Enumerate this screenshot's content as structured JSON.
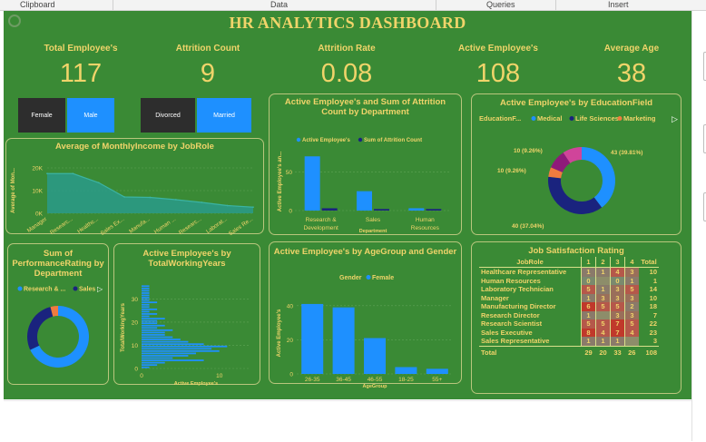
{
  "ribbon": [
    "Clipboard",
    "Data",
    "Queries",
    "Insert"
  ],
  "title": "HR ANALYTICS DASHBOARD",
  "kpis": [
    {
      "label": "Total Employee's",
      "value": "117"
    },
    {
      "label": "Attrition Count",
      "value": "9"
    },
    {
      "label": "Attrition Rate",
      "value": "0.08"
    },
    {
      "label": "Active Employee's",
      "value": "108"
    },
    {
      "label": "Average Age",
      "value": "38"
    }
  ],
  "slicers": {
    "gender": {
      "left": "Female",
      "right": "Male"
    },
    "marital": {
      "left": "Divorced",
      "right": "Married"
    }
  },
  "colors": {
    "dash_bg": "#3a8a35",
    "accent_gold": "#f0d46a",
    "bar_blue": "#1e90ff",
    "navy": "#1a237e",
    "orange": "#f07b3f",
    "purple": "#8e1a7a",
    "pink": "#d0449a"
  },
  "income_chart": {
    "type": "area",
    "title": "Average of MonthlyIncome by JobRole",
    "ylabel": "Average of Mon...",
    "y_ticks": [
      "20K",
      "10K",
      "0K"
    ],
    "ylim": [
      0,
      20000
    ],
    "categories": [
      "Manager",
      "Researc...",
      "Healthc...",
      "Sales Ex...",
      "Manufa...",
      "Human ...",
      "Researc...",
      "Laborat...",
      "Sales Re..."
    ],
    "values": [
      17500,
      17500,
      13500,
      7200,
      7000,
      6000,
      4800,
      3400,
      2700
    ]
  },
  "dept_chart": {
    "type": "bar",
    "title": "Active Employee's and Sum of Attrition Count by Department",
    "legend": [
      "Active Employee's",
      "Sum of Attrition Count"
    ],
    "ylabel": "Active Employee's an...",
    "xlabel": "Department",
    "y_ticks": [
      "50",
      "0"
    ],
    "ylim": [
      0,
      75
    ],
    "categories": [
      "Research & Development",
      "Sales",
      "Human Resources"
    ],
    "cat_lines": [
      [
        "Research &",
        "Development"
      ],
      [
        "Sales"
      ],
      [
        "Human",
        "Resources"
      ]
    ],
    "series": [
      {
        "name": "Active Employee's",
        "values": [
          70,
          25,
          3
        ]
      },
      {
        "name": "Sum of Attrition Count",
        "values": [
          3,
          2,
          2
        ]
      }
    ]
  },
  "edu_chart": {
    "type": "pie",
    "title": "Active Employee's by EducationField",
    "legend_title": "EducationF...",
    "legend": [
      "Medical",
      "Life Sciences",
      "Marketing"
    ],
    "slices": [
      {
        "name": "Medical",
        "value": 43,
        "label": "43 (39.81%)",
        "color": "#1e90ff"
      },
      {
        "name": "Life Sciences",
        "value": 40,
        "label": "40 (37.04%)",
        "color": "#1a237e"
      },
      {
        "name": "Marketing",
        "value": 5,
        "label": "",
        "color": "#f07b3f"
      },
      {
        "name": "",
        "value": 10,
        "label": "10 (9.26%)",
        "color": "#8e1a7a"
      },
      {
        "name": "",
        "value": 10,
        "label": "10 (9.26%)",
        "color": "#d0449a"
      }
    ]
  },
  "perf_chart": {
    "type": "pie",
    "title": "Sum of PerformanceRating by Department",
    "legend": [
      "Research & ...",
      "Sales"
    ],
    "slices": [
      {
        "name": "Research & Development",
        "value": 68,
        "color": "#1e90ff"
      },
      {
        "name": "Sales",
        "value": 28,
        "color": "#1a237e"
      },
      {
        "name": "",
        "value": 4,
        "color": "#f07b3f"
      }
    ]
  },
  "years_chart": {
    "type": "bar",
    "title": "Active Employee's by TotalWorkingYears",
    "ylabel": "TotalWorkingYears",
    "xlabel": "Active Employee's",
    "x_ticks": [
      "0",
      "10"
    ],
    "y_ticks": [
      "30",
      "20",
      "10",
      "0"
    ],
    "ylim": [
      0,
      36
    ],
    "xlim": [
      0,
      14
    ],
    "values": [
      1,
      2,
      3,
      8,
      4,
      6,
      7,
      10,
      9,
      11,
      8,
      6,
      5,
      4,
      3,
      3,
      4,
      2,
      3,
      2,
      2,
      3,
      1,
      2,
      1,
      2,
      1,
      1,
      2,
      1,
      1,
      1,
      1,
      1,
      1,
      1
    ]
  },
  "age_chart": {
    "type": "bar",
    "title": "Active Employee's by AgeGroup and Gender",
    "legend_title": "Gender",
    "legend": [
      "Female"
    ],
    "ylabel": "Active Employee's",
    "xlabel": "AgeGroup",
    "y_ticks": [
      "40",
      "20",
      "0"
    ],
    "ylim": [
      0,
      50
    ],
    "categories": [
      "26-35",
      "36-45",
      "46-55",
      "18-25",
      "55+"
    ],
    "values": [
      41,
      39,
      21,
      4,
      3
    ]
  },
  "satisfaction": {
    "type": "table",
    "title": "Job Satisfaction Rating",
    "headers": [
      "JobRole",
      "1",
      "2",
      "3",
      "4",
      "Total"
    ],
    "rows": [
      [
        "Healthcare Representative",
        "1",
        "1",
        "4",
        "3",
        "10"
      ],
      [
        "Human Resources",
        "0",
        "",
        "0",
        "1",
        "1"
      ],
      [
        "Laboratory Technician",
        "5",
        "1",
        "3",
        "5",
        "14"
      ],
      [
        "Manager",
        "1",
        "3",
        "3",
        "3",
        "10"
      ],
      [
        "Manufacturing Director",
        "6",
        "5",
        "5",
        "2",
        "18"
      ],
      [
        "Research Director",
        "1",
        "",
        "3",
        "3",
        "7"
      ],
      [
        "Research Scientist",
        "5",
        "5",
        "7",
        "5",
        "22"
      ],
      [
        "Sales Executive",
        "8",
        "4",
        "7",
        "4",
        "23"
      ],
      [
        "Sales Representative",
        "1",
        "1",
        "1",
        "",
        "3"
      ]
    ],
    "total": [
      "Total",
      "29",
      "20",
      "33",
      "26",
      "108"
    ]
  }
}
